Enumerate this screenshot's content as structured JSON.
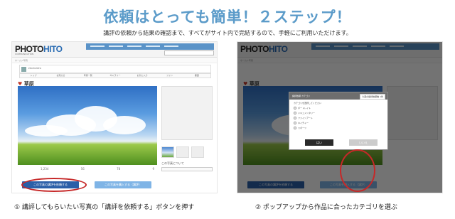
{
  "heading": "依頼はとっても簡単！２ステップ！",
  "subheading": "講評の依頼から結果の確認まで、すべてがサイト内で完結するので、手軽にご利用いただけます。",
  "colors": {
    "accent": "#5b9bc9",
    "brand": "#2a6cb3",
    "highlight": "#c62828"
  },
  "site": {
    "logo_main": "PHOTO",
    "logo_accent": "HITO",
    "logo_sub": "COMMUNICATION",
    "breadcrumb": "ホーム＞写真",
    "username": "PHOTOHITO",
    "tabs": [
      "トップ",
      "お知らせ",
      "写真一覧",
      "ギャラリー",
      "お気に入り",
      "ファン",
      "履歴"
    ],
    "photo_title": "草原",
    "stats": [
      "1,234",
      "56",
      "78",
      "9"
    ],
    "rating_label": "この写真について",
    "button_request": "この写真の講評を依頼する",
    "button_buy": "この写真を購入する（講評）"
  },
  "modal": {
    "title": "講評依頼 カテゴリ",
    "badge": "今週の講評依頼数 1件",
    "prompt": "カテゴリを選択してください",
    "options": [
      "ポートレイト",
      "ドキュメンタリー",
      "ファインアート",
      "ネイチャー",
      "スポーツ"
    ],
    "ok_label": "はい",
    "cancel_label": "いいえ"
  },
  "captions": {
    "step1": "① 講評してもらいたい写真の「講評を依頼する」ボタンを押す",
    "step2": "② ポップアップから作品に合ったカテゴリを選ぶ"
  }
}
